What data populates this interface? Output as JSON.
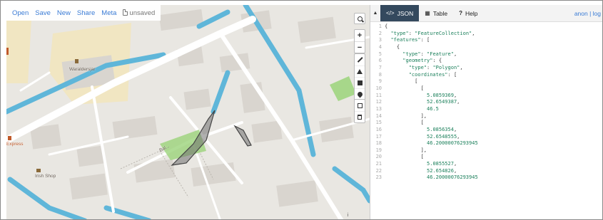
{
  "toolbar": {
    "open": "Open",
    "save": "Save",
    "new": "New",
    "share": "Share",
    "meta": "Meta",
    "unsaved": "unsaved"
  },
  "map": {
    "zoom_in": "+",
    "zoom_out": "−",
    "labels": {
      "park": "Waraldersjar",
      "shop": "Irish Shop",
      "express": "Express",
      "street": "Bal..."
    },
    "attribution": "i",
    "colors": {
      "land": "#e9e7e2",
      "water": "#5fb6d9",
      "road": "#ffffff",
      "building": "#d9d5cf",
      "park": "#f1e6c2",
      "green": "#9bd37a",
      "polygon": "#555555"
    }
  },
  "pane": {
    "tabs": [
      {
        "label": "JSON",
        "icon": "code-icon"
      },
      {
        "label": "Table",
        "icon": "table-icon"
      },
      {
        "label": "Help",
        "icon": "help-icon"
      }
    ],
    "user": "anon | log"
  },
  "editor": {
    "line_numbers": [
      "1",
      "2",
      "3",
      "4",
      "5",
      "6",
      "7",
      "8",
      "9",
      "10",
      "11",
      "12",
      "13",
      "14",
      "15",
      "16",
      "17",
      "18",
      "19",
      "20",
      "21",
      "22",
      "23"
    ],
    "lines": [
      "{",
      "  \"type\": \"FeatureCollection\",",
      "  \"features\": [",
      "    {",
      "      \"type\": \"Feature\",",
      "      \"geometry\": {",
      "        \"type\": \"Polygon\",",
      "        \"coordinates\": [",
      "          [",
      "            [",
      "              5.0859369,",
      "              52.6549387,",
      "              46.5",
      "            ],",
      "            [",
      "              5.0856354,",
      "              52.6548555,",
      "              46.20000076293945",
      "            ],",
      "            [",
      "              5.0855527,",
      "              52.654826,",
      "              46.20000076293945"
    ]
  }
}
